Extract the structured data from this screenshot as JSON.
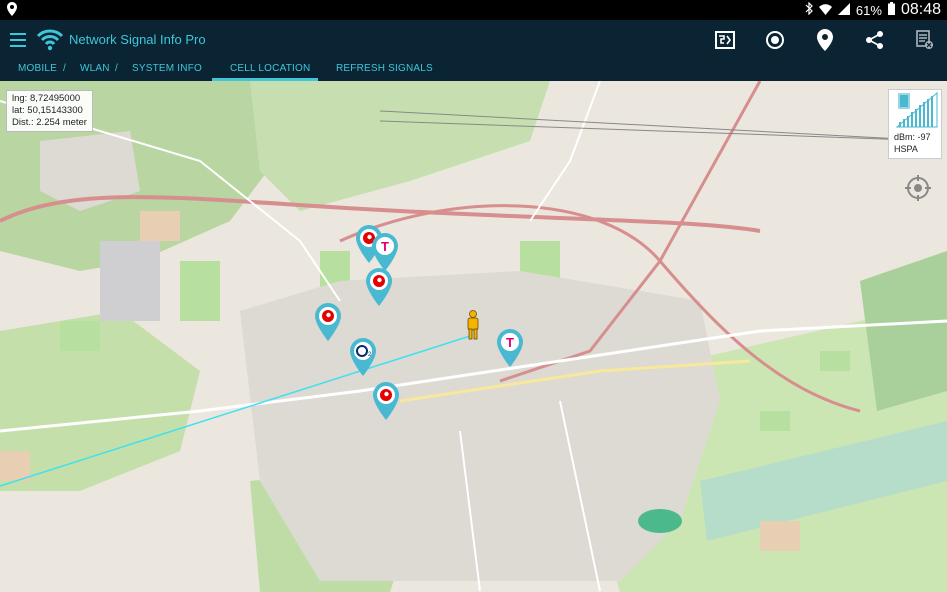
{
  "status": {
    "battery": "61%",
    "time": "08:48"
  },
  "app": {
    "title": "Network Signal Info Pro"
  },
  "tabs": {
    "mobile": "MOBILE",
    "wlan": "WLAN",
    "system_info": "SYSTEM INFO",
    "cell_location": "CELL LOCATION",
    "refresh_signals": "REFRESH SIGNALS",
    "separator": "/"
  },
  "coords": {
    "lng": "lng: 8,72495000",
    "lat": "lat: 50,15143300",
    "dist": "Dist.: 2.254 meter"
  },
  "signal": {
    "dbm": "dBm: -97",
    "tech": "HSPA"
  },
  "colors": {
    "accent": "#3fc6d8",
    "appbar": "#0a2433"
  }
}
